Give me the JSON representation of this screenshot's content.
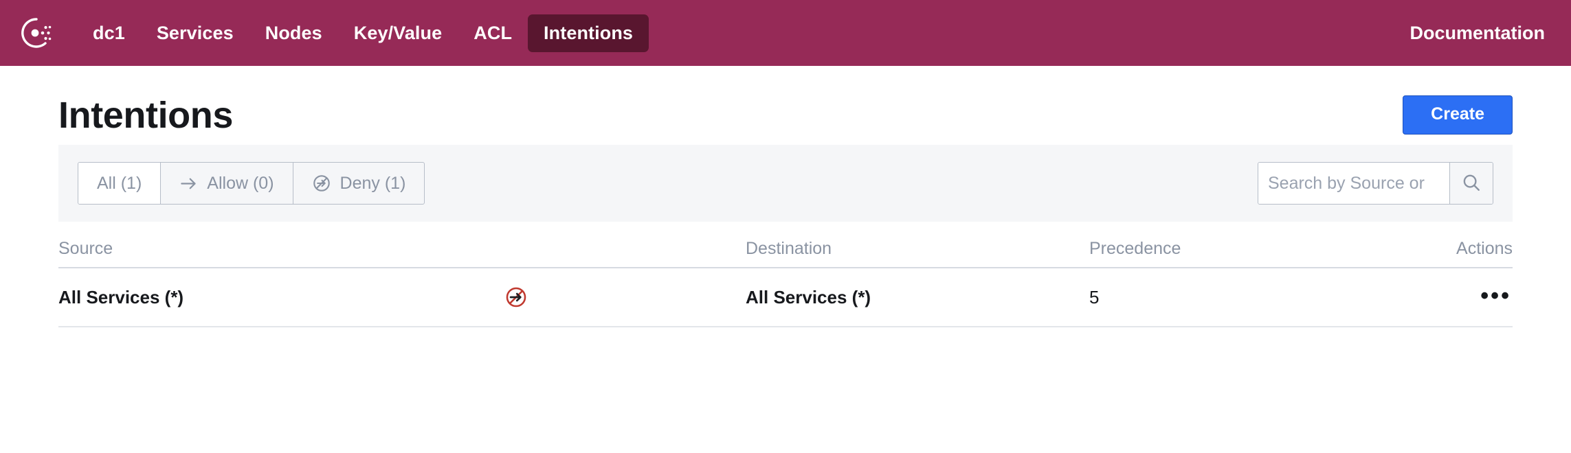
{
  "navbar": {
    "brand_icon": "consul-logo-icon",
    "background_color": "#962a57",
    "active_background_color": "#59162f",
    "links": [
      {
        "label": "dc1",
        "name": "datacenter",
        "active": false
      },
      {
        "label": "Services",
        "name": "services",
        "active": false
      },
      {
        "label": "Nodes",
        "name": "nodes",
        "active": false
      },
      {
        "label": "Key/Value",
        "name": "key-value",
        "active": false
      },
      {
        "label": "ACL",
        "name": "acl",
        "active": false
      },
      {
        "label": "Intentions",
        "name": "intentions",
        "active": true
      }
    ],
    "documentation_label": "Documentation"
  },
  "header": {
    "title": "Intentions",
    "create_label": "Create",
    "create_color": "#2c6ff4"
  },
  "filters": {
    "tabs": [
      {
        "label": "All (1)",
        "icon": null,
        "active": true
      },
      {
        "label": "Allow (0)",
        "icon": "arrow-right-icon",
        "active": false
      },
      {
        "label": "Deny (1)",
        "icon": "deny-circle-icon",
        "active": false
      }
    ],
    "search": {
      "value": "",
      "placeholder": "Search by Source or",
      "button_icon": "search-icon"
    }
  },
  "table": {
    "columns": [
      {
        "key": "source",
        "label": "Source"
      },
      {
        "key": "destination",
        "label": "Destination"
      },
      {
        "key": "precedence",
        "label": "Precedence"
      },
      {
        "key": "actions",
        "label": "Actions"
      }
    ],
    "rows": [
      {
        "source": "All Services (*)",
        "action_icon": "deny-arrow-icon",
        "action_icon_color": "#c0392f",
        "destination": "All Services (*)",
        "precedence": "5",
        "actions_label": "•••"
      }
    ]
  }
}
